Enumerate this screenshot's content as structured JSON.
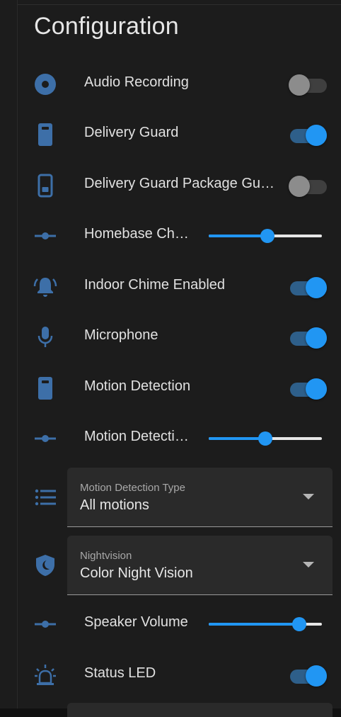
{
  "title": "Configuration",
  "rows": {
    "audio_recording": {
      "label": "Audio Recording",
      "icon": "record-circle-icon",
      "on": false
    },
    "delivery_guard": {
      "label": "Delivery Guard",
      "icon": "doorbell-icon",
      "on": true
    },
    "delivery_guard_package": {
      "label": "Delivery Guard Package Guarding",
      "icon": "doorbell-outline-icon",
      "on": false
    },
    "homebase_chime": {
      "label": "Homebase Chime Volume",
      "icon": "slider-icon",
      "value_fraction": 0.52
    },
    "indoor_chime": {
      "label": "Indoor Chime Enabled",
      "icon": "bell-ring-icon",
      "on": true
    },
    "microphone": {
      "label": "Microphone",
      "icon": "microphone-icon",
      "on": true
    },
    "motion_detection": {
      "label": "Motion Detection",
      "icon": "doorbell-icon",
      "on": true
    },
    "motion_sensitivity": {
      "label": "Motion Detection Sensitivity",
      "icon": "slider-icon",
      "value_fraction": 0.5
    },
    "motion_type": {
      "label": "Motion Detection Type",
      "value": "All motions",
      "icon": "list-icon"
    },
    "nightvision": {
      "label": "Nightvision",
      "value": "Color Night Vision",
      "icon": "shield-moon-icon"
    },
    "speaker_volume": {
      "label": "Speaker Volume",
      "icon": "slider-icon",
      "value_fraction": 0.8
    },
    "status_led": {
      "label": "Status LED",
      "icon": "alarm-light-icon",
      "on": true
    }
  },
  "colors": {
    "accent": "#2196f3",
    "icon": "#3d6fa8",
    "background": "#1c1c1c"
  }
}
